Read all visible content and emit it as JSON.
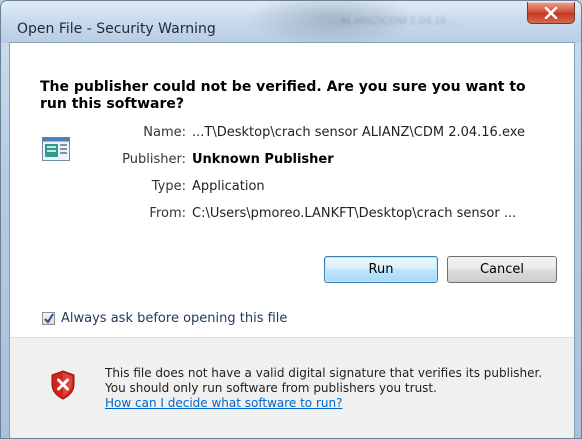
{
  "window": {
    "title": "Open File - Security Warning",
    "background_blur_text": "...ALIANZ\\CDM 2.04.16 ..."
  },
  "headline": "The publisher could not be verified.  Are you sure you want to run this software?",
  "fields": [
    {
      "label": "Name:",
      "value": "...T\\Desktop\\crach sensor ALIANZ\\CDM 2.04.16.exe",
      "bold": false
    },
    {
      "label": "Publisher:",
      "value": "Unknown Publisher",
      "bold": true
    },
    {
      "label": "Type:",
      "value": "Application",
      "bold": false
    },
    {
      "label": "From:",
      "value": "C:\\Users\\pmoreo.LANKFT\\Desktop\\crach sensor ...",
      "bold": false
    }
  ],
  "buttons": {
    "run": "Run",
    "cancel": "Cancel"
  },
  "checkbox": {
    "label": "Always ask before opening this file",
    "checked": true
  },
  "footer": {
    "message": "This file does not have a valid digital signature that verifies its publisher.  You should only run software from publishers you trust.",
    "link": "How can I decide what software to run?"
  },
  "icons": {
    "file": "file-icon",
    "shield": "shield-warning-icon",
    "close": "close-icon",
    "check": "check-icon"
  },
  "colors": {
    "link": "#0066cc",
    "close_button": "#c9442b",
    "shield_red": "#d2241c",
    "default_button_border": "#3c7fb1"
  }
}
